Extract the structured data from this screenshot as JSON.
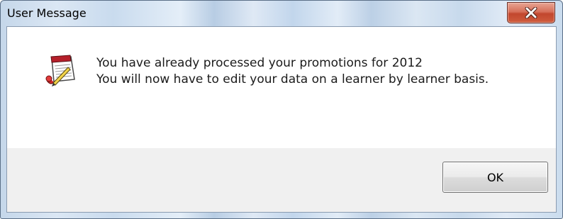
{
  "window": {
    "title": "User Message",
    "close_icon": "close-icon"
  },
  "message": {
    "icon": "notepad-edit-icon",
    "line1": "You have already processed your promotions for 2012",
    "line2": "You will now have to edit your data on a learner by learner basis."
  },
  "buttons": {
    "ok_label": "OK"
  },
  "colors": {
    "close_button": "#c7503a",
    "footer_background": "#f0f0f0",
    "content_background": "#ffffff"
  }
}
